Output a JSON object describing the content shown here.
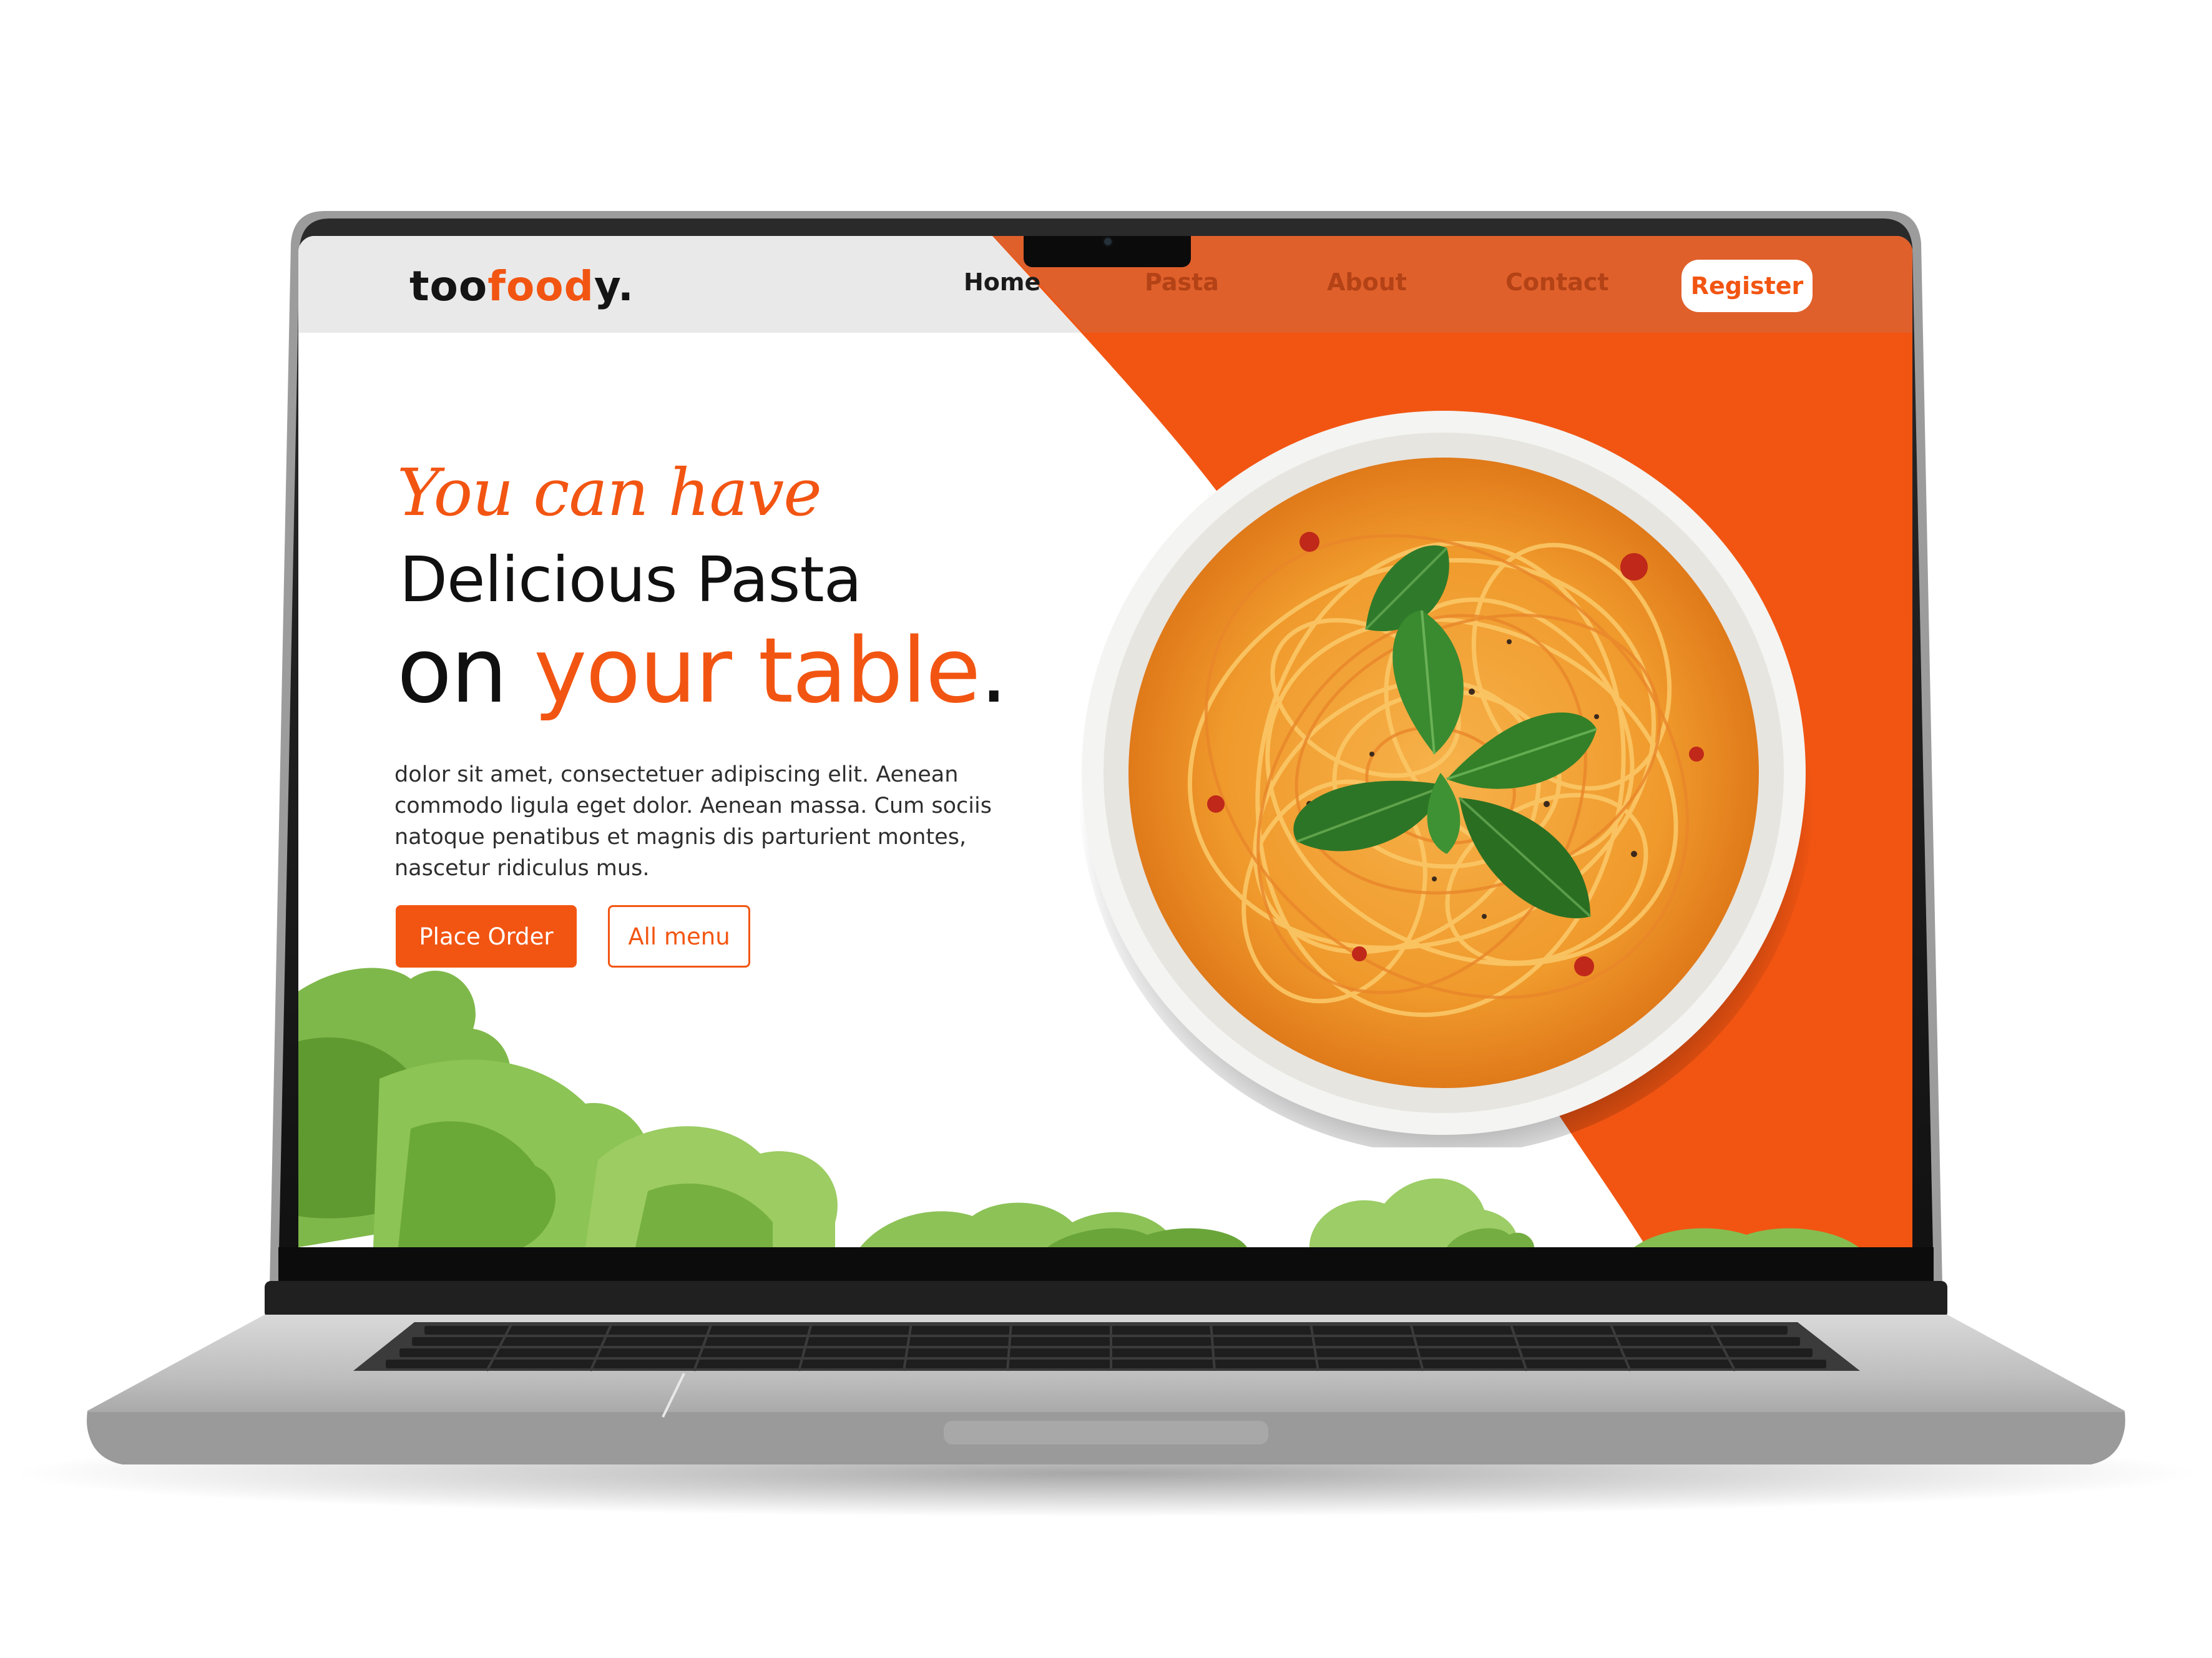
{
  "brand": {
    "logo_prefix": "too",
    "logo_accent": "food",
    "logo_suffix": "y."
  },
  "nav": {
    "items": [
      {
        "label": "Home",
        "active": true
      },
      {
        "label": "Pasta",
        "active": false
      },
      {
        "label": "About",
        "active": false
      },
      {
        "label": "Contact",
        "active": false
      }
    ],
    "register_label": "Register"
  },
  "hero": {
    "script_line": "You can have",
    "line2": "Delicious Pasta",
    "line3_prefix": "on ",
    "line3_accent": "your table",
    "line3_suffix": ".",
    "body": "dolor sit amet, consectetuer adipiscing elit. Aenean commodo ligula eget dolor. Aenean massa. Cum sociis natoque penatibus et magnis dis parturient montes, nascetur ridiculus mus.",
    "primary_button": "Place Order",
    "secondary_button": "All menu"
  },
  "images": {
    "hero_dish": "spaghetti-bowl-with-basil",
    "decoration": "lettuce-leaves"
  },
  "colors": {
    "accent": "#f25512",
    "nav_background": "#e9e9e9",
    "text_dark": "#101010",
    "laptop_body": "#c8c8c8"
  }
}
